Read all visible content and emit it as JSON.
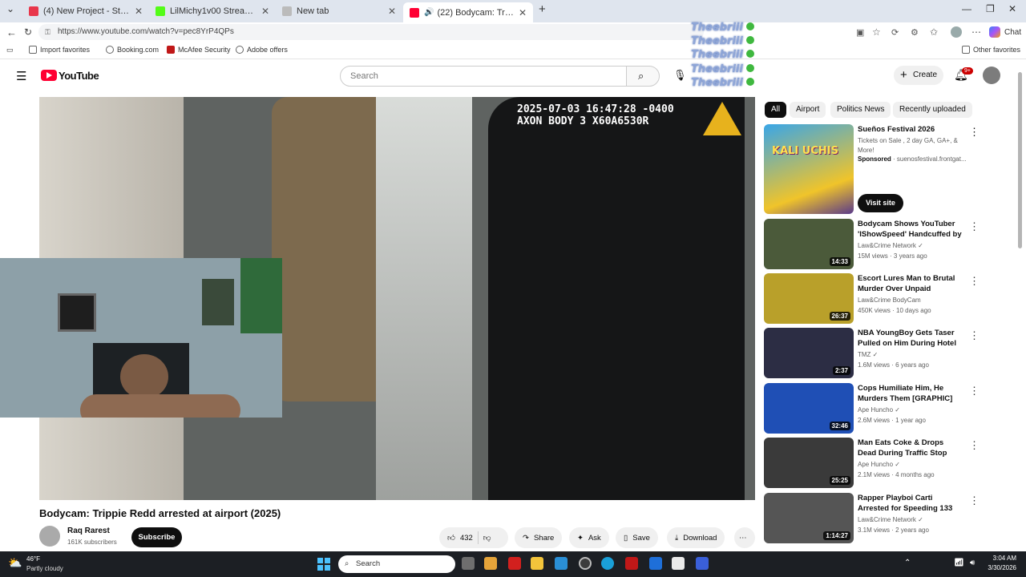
{
  "browser": {
    "tabs": [
      {
        "label": "(4) New Project - Studio",
        "color": "#e8364b",
        "active": false
      },
      {
        "label": "LilMichy1v00 Stream - Watch Live",
        "color": "#53fc18",
        "active": false
      },
      {
        "label": "New tab",
        "color": "#888888",
        "active": false
      },
      {
        "label": "(22) Bodycam: Trippie Redd ar",
        "color": "#ff0033",
        "active": true
      }
    ],
    "url": "https://www.youtube.com/watch?v=pec8YrP4QPs",
    "chat_label": "Chat",
    "bookmarks": [
      "Import favorites",
      "Booking.com",
      "McAfee Security",
      "Adobe offers"
    ],
    "other_favorites": "Other favorites"
  },
  "overlay": {
    "names": [
      "Theebriii",
      "Theebriii",
      "Theebriii",
      "Theebriii",
      "Theebriii"
    ]
  },
  "youtube": {
    "logo": "YouTube",
    "search_placeholder": "Search",
    "create": "Create",
    "notif_badge": "9+",
    "video": {
      "timestamp": "2025-07-03 16:47:28 -0400",
      "device": "AXON BODY 3 X60A6530R",
      "title": "Bodycam: Trippie Redd arrested at airport (2025)",
      "channel": "Raq Rarest",
      "subs": "161K subscribers",
      "subscribe": "Subscribe",
      "likes": "432",
      "share": "Share",
      "ask": "Ask",
      "save": "Save",
      "download": "Download"
    },
    "chips": [
      "All",
      "Airport",
      "Politics News",
      "Recently uploaded"
    ],
    "ad": {
      "title": "Sueños Festival 2026",
      "desc": "Tickets on Sale , 2 day GA, GA+, & More!",
      "sponsored": "Sponsored",
      "domain": "· suenosfestival.frontgat...",
      "cta": "Visit site",
      "thumb_text": "KALI UCHIS"
    },
    "recs": [
      {
        "title": "Bodycam Shows YouTuber 'IShowSpeed' Handcuffed by ...",
        "channel": "Law&Crime Network",
        "views": "15M views · 3 years ago",
        "duration": "14:33",
        "color": "#4b5a3a"
      },
      {
        "title": "Escort Lures Man to Brutal Murder Over Unpaid Services",
        "channel": "Law&Crime BodyCam",
        "views": "450K views · 10 days ago",
        "duration": "26:37",
        "color": "#b9a02a"
      },
      {
        "title": "NBA YoungBoy Gets Taser Pulled on Him During Hotel ...",
        "channel": "TMZ",
        "views": "1.6M views · 6 years ago",
        "duration": "2:37",
        "color": "#2c2d44"
      },
      {
        "title": "Cops Humiliate Him, He Murders Them [GRAPHIC]",
        "channel": "Ape Huncho",
        "views": "2.6M views · 1 year ago",
        "duration": "32:46",
        "color": "#1f4fb5"
      },
      {
        "title": "Man Eats Coke & Drops Dead During Traffic Stop",
        "channel": "Ape Huncho",
        "views": "2.1M views · 4 months ago",
        "duration": "25:25",
        "color": "#3a3a3a"
      },
      {
        "title": "Rapper Playboi Carti Arrested for Speeding 133 mph on ...",
        "channel": "Law&Crime Network",
        "views": "3.1M views · 2 years ago",
        "duration": "1:14:27",
        "color": "#555555"
      }
    ]
  },
  "taskbar": {
    "weather_temp": "46°F",
    "weather_desc": "Partly cloudy",
    "search": "Search",
    "time": "3:04 AM",
    "date": "3/30/2026"
  }
}
